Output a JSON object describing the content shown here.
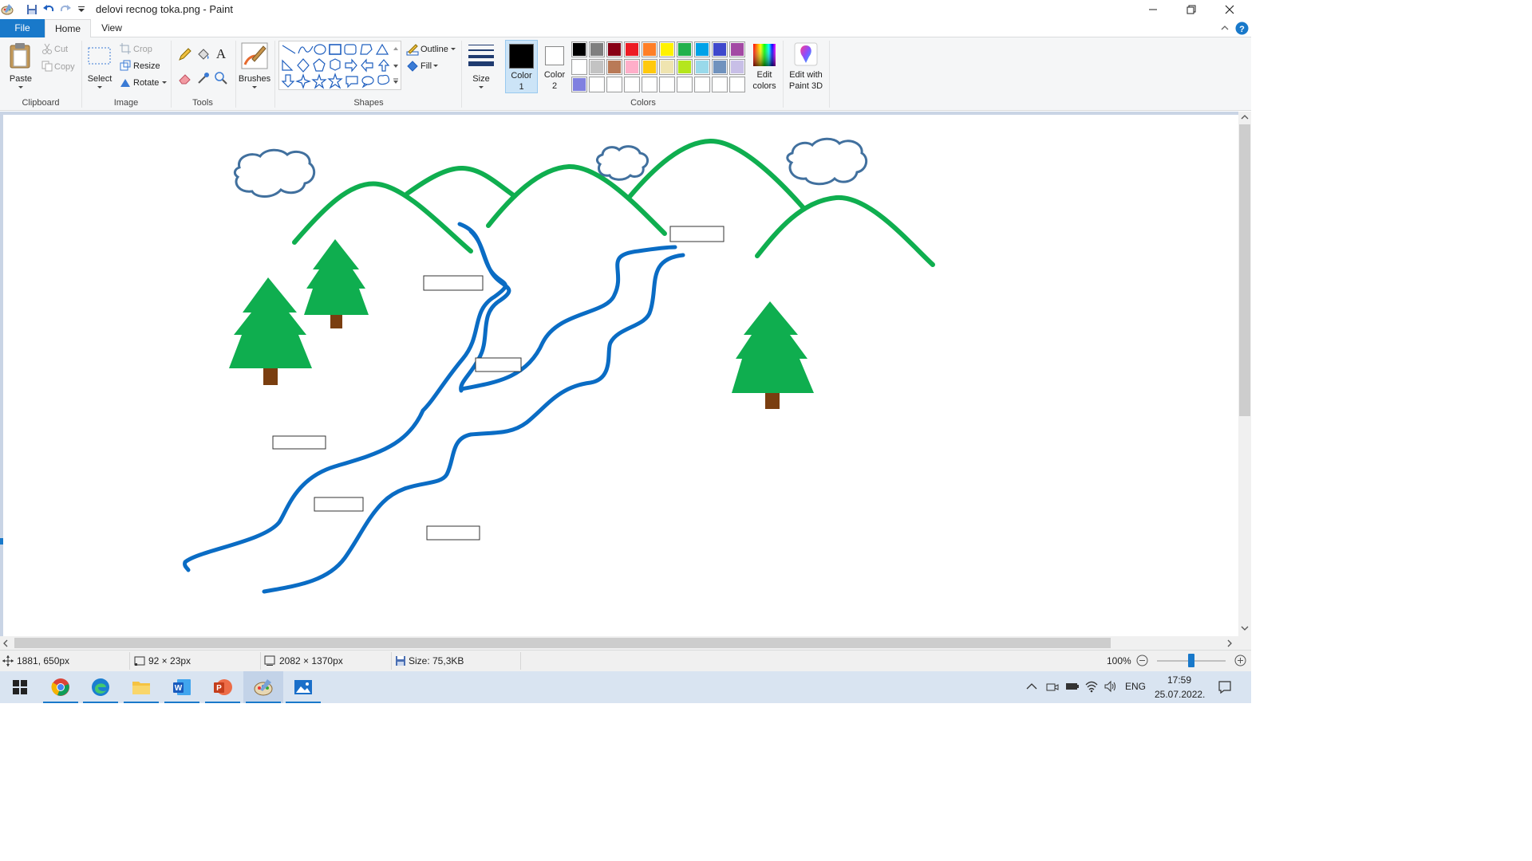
{
  "window": {
    "title": "delovi recnog toka.png - Paint"
  },
  "tabs": {
    "file": "File",
    "home": "Home",
    "view": "View"
  },
  "ribbon": {
    "clipboard": {
      "paste": "Paste",
      "cut": "Cut",
      "copy": "Copy",
      "group": "Clipboard"
    },
    "image": {
      "select": "Select",
      "crop": "Crop",
      "resize": "Resize",
      "rotate": "Rotate",
      "group": "Image"
    },
    "tools": {
      "group": "Tools"
    },
    "brushes": "Brushes",
    "shapes": {
      "outline": "Outline",
      "fill": "Fill",
      "group": "Shapes"
    },
    "size": "Size",
    "colors": {
      "color1": "Color 1",
      "color1_a": "Color",
      "color1_b": "1",
      "color2_a": "Color",
      "color2_b": "2",
      "edit_a": "Edit",
      "edit_b": "colors",
      "paint3d_a": "Edit with",
      "paint3d_b": "Paint 3D",
      "group": "Colors",
      "palette_row1": [
        "#000000",
        "#7f7f7f",
        "#880015",
        "#ed1c24",
        "#ff7f27",
        "#fff200",
        "#22b14c",
        "#00a2e8",
        "#3f48cc",
        "#a349a4"
      ],
      "palette_row2": [
        "#ffffff",
        "#c3c3c3",
        "#b97a57",
        "#ffaec9",
        "#ffc90e",
        "#efe4b0",
        "#b5e61d",
        "#99d9ea",
        "#7092be",
        "#c8bfe7"
      ],
      "palette_row3": [
        "#8080e0",
        "#ffffff",
        "#ffffff",
        "#ffffff",
        "#ffffff",
        "#ffffff",
        "#ffffff",
        "#ffffff",
        "#ffffff",
        "#ffffff"
      ]
    }
  },
  "drawing": {
    "mountain_color": "#0fae4f",
    "river_color": "#0a6cc4",
    "tree_color": "#0fae4f",
    "trunk_color": "#7a3e10",
    "cloud_color": "#41709e"
  },
  "status": {
    "cursor": "1881, 650px",
    "selection": "92 × 23px",
    "image_size": "2082 × 1370px",
    "file_size": "Size: 75,3KB",
    "zoom": "100%"
  },
  "taskbar": {
    "lang": "ENG",
    "time": "17:59",
    "date": "25.07.2022."
  }
}
